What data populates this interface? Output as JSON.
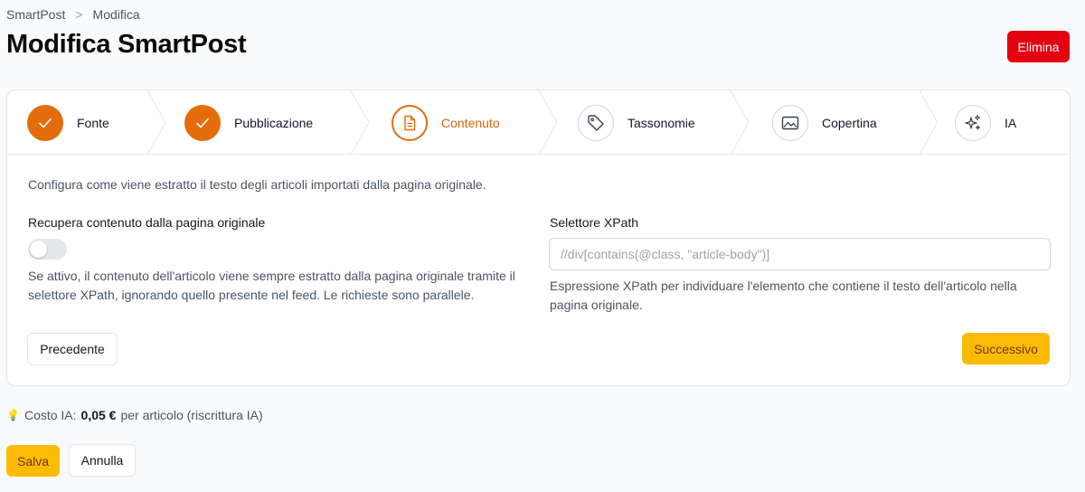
{
  "breadcrumb": {
    "items": [
      "SmartPost",
      "Modifica"
    ],
    "separator": ">"
  },
  "header": {
    "title": "Modifica SmartPost",
    "delete_label": "Elimina"
  },
  "steps": [
    {
      "label": "Fonte",
      "status": "done",
      "icon": "check-icon"
    },
    {
      "label": "Pubblicazione",
      "status": "done",
      "icon": "check-icon"
    },
    {
      "label": "Contenuto",
      "status": "current",
      "icon": "document-icon"
    },
    {
      "label": "Tassonomie",
      "status": "todo",
      "icon": "tag-icon"
    },
    {
      "label": "Copertina",
      "status": "todo",
      "icon": "image-icon"
    },
    {
      "label": "IA",
      "status": "todo",
      "icon": "sparkles-icon"
    }
  ],
  "content": {
    "description": "Configura come viene estratto il testo degli articoli importati dalla pagina originale.",
    "fetch_label": "Recupera contenuto dalla pagina originale",
    "fetch_enabled": false,
    "fetch_help": "Se attivo, il contenuto dell'articolo viene sempre estratto dalla pagina originale tramite il selettore XPath, ignorando quello presente nel feed. Le richieste sono parallele.",
    "xpath_label": "Selettore XPath",
    "xpath_value": "",
    "xpath_placeholder": "//div[contains(@class, \"article-body\")]",
    "xpath_help": "Espressione XPath per individuare l'elemento che contiene il testo dell'articolo nella pagina originale."
  },
  "nav": {
    "prev_label": "Precedente",
    "next_label": "Successivo"
  },
  "cost": {
    "prefix": "Costo IA:",
    "amount": "0,05 €",
    "suffix": "per articolo (riscrittura IA)"
  },
  "footer": {
    "save_label": "Salva",
    "cancel_label": "Annulla"
  },
  "colors": {
    "accent": "#e36d0a",
    "primary_button": "#fdbb05",
    "danger": "#e3000f"
  }
}
